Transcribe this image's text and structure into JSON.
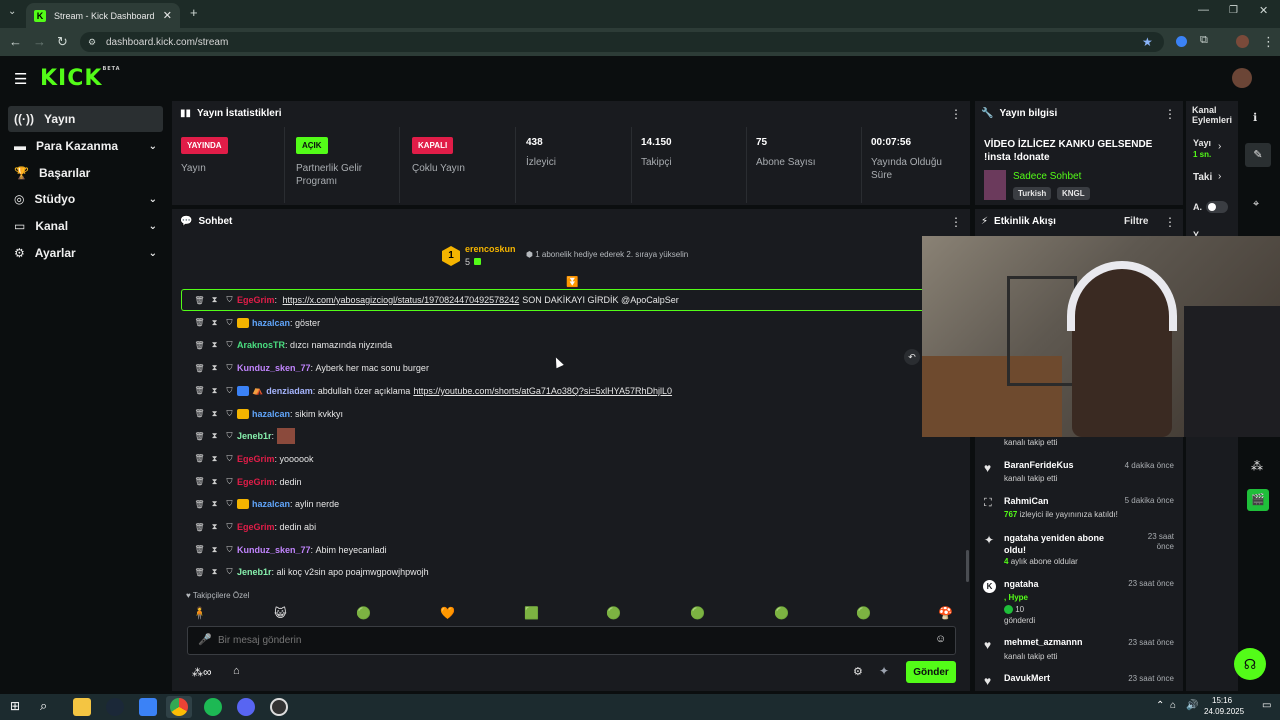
{
  "browser": {
    "tab_title": "Stream - Kick Dashboard",
    "url": "dashboard.kick.com/stream"
  },
  "app": {
    "logo": "KICK",
    "logo_badge": "BETA"
  },
  "sidebar": {
    "items": [
      {
        "label": "Yayın",
        "icon": "broadcast-icon",
        "active": true
      },
      {
        "label": "Para Kazanma",
        "icon": "money-icon"
      },
      {
        "label": "Başarılar",
        "icon": "trophy-icon"
      },
      {
        "label": "Stüdyo",
        "icon": "studio-icon"
      },
      {
        "label": "Kanal",
        "icon": "channel-icon"
      },
      {
        "label": "Ayarlar",
        "icon": "gear-icon"
      }
    ]
  },
  "stats": {
    "title": "Yayın İstatistikleri",
    "cells": [
      {
        "badge": "YAYINDA",
        "badge_color": "#e11d48",
        "label": "Yayın"
      },
      {
        "badge": "AÇIK",
        "badge_color": "#53fc18",
        "label": "Partnerlik Gelir Programı"
      },
      {
        "badge": "KAPALI",
        "badge_color": "#e11d48",
        "label": "Çoklu Yayın"
      },
      {
        "value": "438",
        "label": "İzleyici"
      },
      {
        "value": "14.150",
        "label": "Takipçi"
      },
      {
        "value": "75",
        "label": "Abone Sayısı"
      },
      {
        "value": "00:07:56",
        "label": "Yayında Olduğu Süre"
      }
    ]
  },
  "stream_info": {
    "title": "Yayın bilgisi",
    "stream_title": "VİDEO İZLİCEZ KANKU GELSENDE !insta !donate",
    "category": "Sadece Sohbet",
    "tags": [
      "Turkish",
      "KNGL"
    ]
  },
  "right_strip": {
    "title": "Kanal Eylemleri",
    "items": [
      "Yayı",
      "1 sn.",
      "Taki",
      "A.",
      "Y."
    ]
  },
  "chat": {
    "title": "Sohbet",
    "top_gifter": {
      "name": "erencoskun",
      "rank": "1",
      "count": "5"
    },
    "gift_hint": "1 abonelik hediye ederek 2. sıraya yükselin",
    "messages": [
      {
        "user": "EgeGrim",
        "color": "#e11d48",
        "text": "",
        "link": "https://x.com/yabosagizciogl/status/1970824470492578242",
        "after": "SON DAKİKAYI GİRDİK @ApoCalpSer"
      },
      {
        "user": "hazalcan",
        "color": "#60a5fa",
        "text": "göster",
        "crown": true
      },
      {
        "user": "AraknosTR",
        "color": "#4ade80",
        "text": "dızcı namazında niyzında"
      },
      {
        "user": "Kunduz_sken_77",
        "color": "#c084fc",
        "text": "Ayberk her mac sonu burger"
      },
      {
        "user": "denziadam",
        "color": "#a5b4fc",
        "text": "abdullah özer açıklama",
        "link": "https://youtube.com/shorts/atGa71Ao38Q?si=5xlHYA57RhDhjlL0",
        "after": ""
      },
      {
        "user": "hazalcan",
        "color": "#60a5fa",
        "text": "sikim kvkkyı",
        "crown": true
      },
      {
        "user": "Jeneb1r",
        "color": "#86efac",
        "text": ""
      },
      {
        "user": "EgeGrim",
        "color": "#e11d48",
        "text": "yoooook"
      },
      {
        "user": "EgeGrim",
        "color": "#e11d48",
        "text": "dedin"
      },
      {
        "user": "hazalcan",
        "color": "#60a5fa",
        "text": "aylin nerde",
        "crown": true
      },
      {
        "user": "EgeGrim",
        "color": "#e11d48",
        "text": "dedin abi"
      },
      {
        "user": "Kunduz_sken_77",
        "color": "#c084fc",
        "text": "Abim heyecanladi"
      },
      {
        "user": "Jeneb1r",
        "color": "#86efac",
        "text": "ali koç v2sin apo poajmwgpowjhpwojh"
      }
    ],
    "emote_section": "Takipçilere Özel",
    "input_placeholder": "Bir mesaj gönderin",
    "send_label": "Gönder",
    "infinity": "∞"
  },
  "activity": {
    "title": "Etkinlik Akışı",
    "filter_label": "Filtre",
    "events": [
      {
        "icon": "heart-icon",
        "user": "",
        "sub": "kanalı takip etti",
        "time": ""
      },
      {
        "icon": "heart-icon",
        "user": "BaranFerideKus",
        "sub": "kanalı takip etti",
        "time": "4 dakika önce"
      },
      {
        "icon": "raid-icon",
        "user": "RahmiCan",
        "highlight": "767",
        "sub": "izleyici ile yayınınıza katıldı!",
        "time": "5 dakika önce"
      },
      {
        "icon": "star-icon",
        "user": "ngataha yeniden abone oldu!",
        "highlight": "4",
        "sub": "aylık abone oldular",
        "time": "23 saat önce"
      },
      {
        "icon": "kick-icon",
        "user": "ngataha",
        "extra": ", Hype",
        "kicks": "10",
        "sub": "gönderdi",
        "time": "23 saat önce"
      },
      {
        "icon": "heart-icon",
        "user": "mehmet_azmannn",
        "sub": "kanalı takip etti",
        "time": "23 saat önce"
      },
      {
        "icon": "heart-icon",
        "user": "DavukMert",
        "sub": "",
        "time": "23 saat önce"
      }
    ]
  },
  "taskbar": {
    "time": "15:16",
    "date": "24.09.2025"
  }
}
